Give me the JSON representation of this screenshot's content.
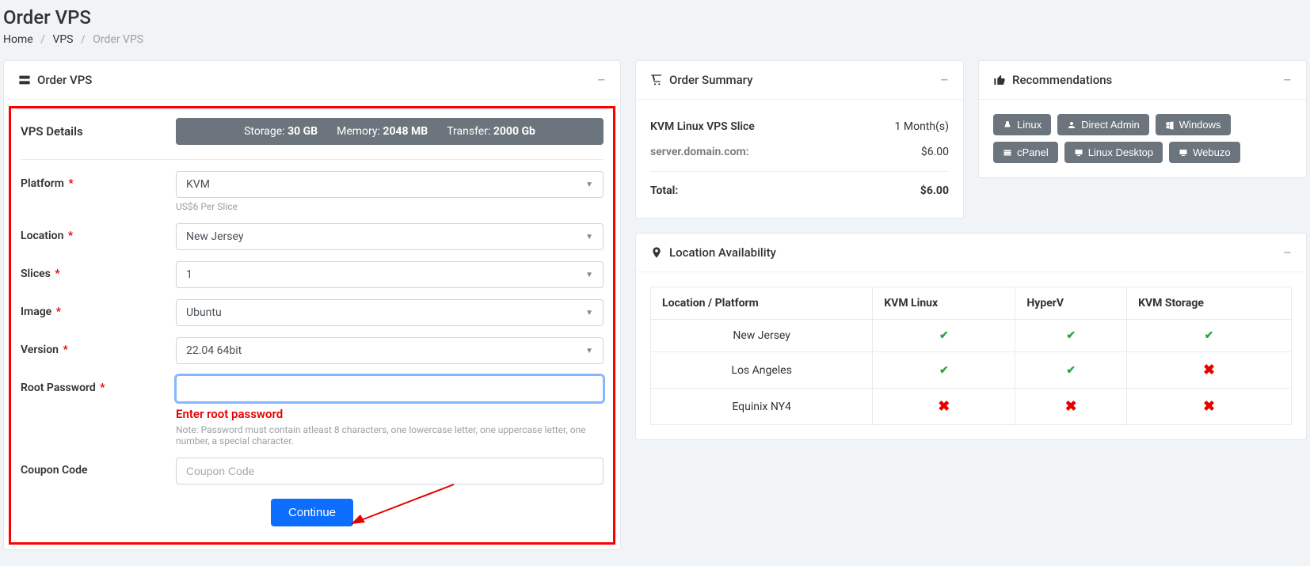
{
  "page": {
    "title": "Order VPS",
    "breadcrumb": {
      "home": "Home",
      "vps": "VPS",
      "current": "Order VPS"
    }
  },
  "order_card": {
    "header": "Order VPS",
    "details_label": "VPS Details",
    "specs": {
      "storage_label": "Storage:",
      "storage_value": "30 GB",
      "memory_label": "Memory:",
      "memory_value": "2048 MB",
      "transfer_label": "Transfer:",
      "transfer_value": "2000 Gb"
    },
    "fields": {
      "platform": {
        "label": "Platform",
        "value": "KVM",
        "helper": "US$6 Per Slice"
      },
      "location": {
        "label": "Location",
        "value": "New Jersey"
      },
      "slices": {
        "label": "Slices",
        "value": "1"
      },
      "image": {
        "label": "Image",
        "value": "Ubuntu"
      },
      "version": {
        "label": "Version",
        "value": "22.04 64bit"
      },
      "root_password": {
        "label": "Root Password",
        "value": "",
        "error": "Enter root password",
        "note": "Note: Password must contain atleast 8 characters, one lowercase letter, one uppercase letter, one number, a special character."
      },
      "coupon": {
        "label": "Coupon Code",
        "placeholder": "Coupon Code"
      }
    },
    "continue": "Continue"
  },
  "summary": {
    "header": "Order Summary",
    "product": "KVM Linux VPS Slice",
    "duration": "1 Month(s)",
    "hostname_label": "server.domain.com:",
    "hostname_price": "$6.00",
    "total_label": "Total:",
    "total_value": "$6.00"
  },
  "recommendations": {
    "header": "Recommendations",
    "items": [
      "Linux",
      "Direct Admin",
      "Windows",
      "cPanel",
      "Linux Desktop",
      "Webuzo"
    ]
  },
  "availability": {
    "header": "Location Availability",
    "columns": [
      "Location / Platform",
      "KVM Linux",
      "HyperV",
      "KVM Storage"
    ],
    "rows": [
      {
        "location": "New Jersey",
        "cells": [
          "yes",
          "yes",
          "yes"
        ]
      },
      {
        "location": "Los Angeles",
        "cells": [
          "yes",
          "yes",
          "no"
        ]
      },
      {
        "location": "Equinix NY4",
        "cells": [
          "no",
          "no",
          "no"
        ]
      }
    ]
  }
}
